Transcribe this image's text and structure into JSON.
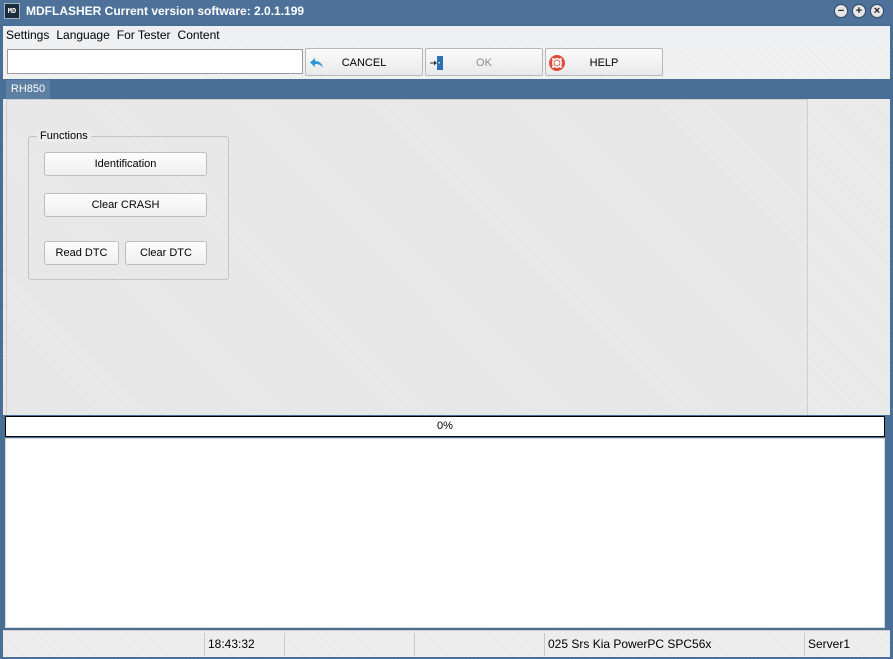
{
  "window": {
    "title": "MDFLASHER  Current version software: 2.0.1.199",
    "app_icon": "mdflasher-logo-icon",
    "controls": {
      "minimize": "−",
      "maximize": "+",
      "close": "×"
    }
  },
  "menu": {
    "items": [
      {
        "label": "Settings"
      },
      {
        "label": "Language"
      },
      {
        "label": "For Tester"
      },
      {
        "label": "Content"
      }
    ]
  },
  "toolbar": {
    "path_value": "",
    "cancel_label": "CANCEL",
    "cancel_icon": "back-arrow-icon",
    "ok_label": "OK",
    "ok_icon": "door-enter-icon",
    "ok_enabled": false,
    "help_label": "HELP",
    "help_icon": "lifebuoy-icon"
  },
  "tabs": [
    {
      "label": "RH850",
      "active": true
    }
  ],
  "functions": {
    "group_title": "Functions",
    "identification_label": "Identification",
    "clear_crash_label": "Clear CRASH",
    "read_dtc_label": "Read DTC",
    "clear_dtc_label": "Clear DTC"
  },
  "progress": {
    "value": 0,
    "text": "0%"
  },
  "status": {
    "cell1": "",
    "time": "18:43:32",
    "cell3": "",
    "cell4": "",
    "module": "025 Srs Kia PowerPC SPC56x",
    "server": "Server1"
  },
  "colors": {
    "title_bar": "#4d7199",
    "tab_active": "#5d7fa3",
    "accent_blue": "#2a9ad6",
    "help_red": "#e04a3a"
  }
}
